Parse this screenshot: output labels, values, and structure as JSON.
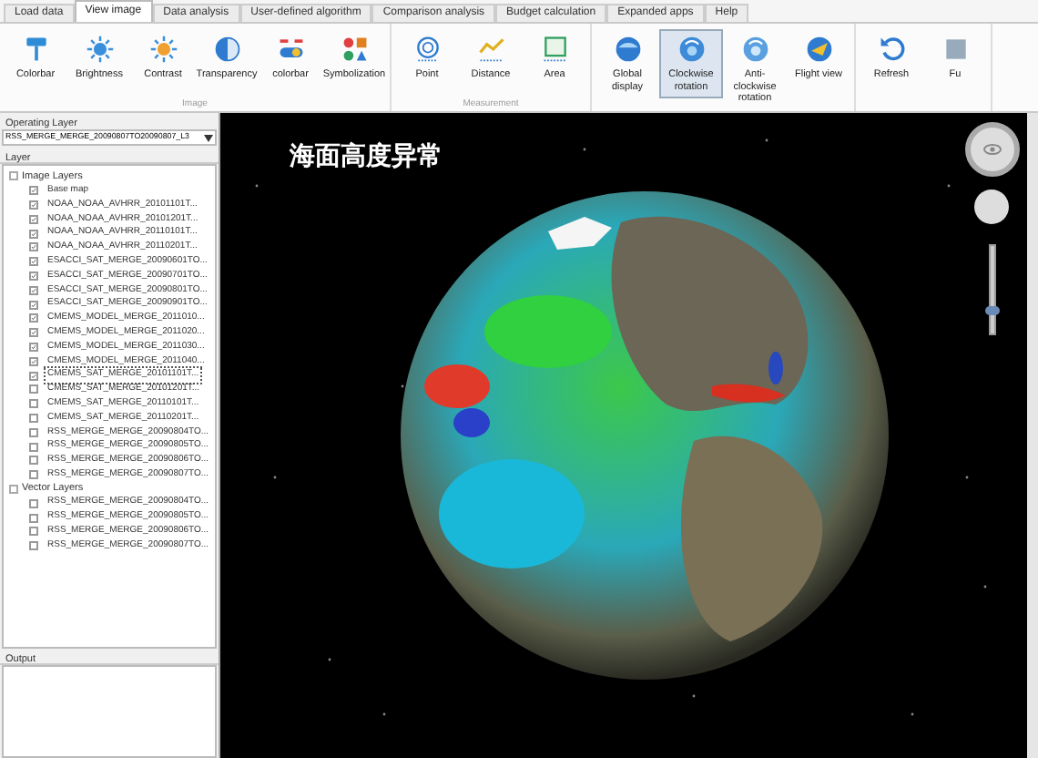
{
  "tabs": [
    {
      "label": "Load data",
      "selected": false
    },
    {
      "label": "View image",
      "selected": true
    },
    {
      "label": "Data analysis",
      "selected": false
    },
    {
      "label": "User-defined algorithm",
      "selected": false
    },
    {
      "label": "Comparison analysis",
      "selected": false
    },
    {
      "label": "Budget calculation",
      "selected": false
    },
    {
      "label": "Expanded apps",
      "selected": false
    },
    {
      "label": "Help",
      "selected": false
    }
  ],
  "ribbon": [
    {
      "group": "Image",
      "buttons": [
        {
          "label": "Colorbar",
          "selected": false
        },
        {
          "label": "Brightness",
          "selected": false
        },
        {
          "label": "Contrast",
          "selected": false
        },
        {
          "label": "Transparency",
          "selected": false
        },
        {
          "label": "colorbar",
          "selected": false
        },
        {
          "label": "Symbolization",
          "selected": false
        }
      ]
    },
    {
      "group": "Measurement",
      "buttons": [
        {
          "label": "Point",
          "selected": false
        },
        {
          "label": "Distance",
          "selected": false
        },
        {
          "label": "Area",
          "selected": false
        }
      ]
    },
    {
      "buttons": [
        {
          "label": "Global display",
          "selected": false
        },
        {
          "label": "Clockwise rotation",
          "selected": true
        },
        {
          "label": "Anti-clockwise rotation",
          "selected": false
        },
        {
          "label": "Flight view",
          "selected": false
        }
      ]
    },
    {
      "buttons": [
        {
          "label": "Refresh",
          "selected": false
        },
        {
          "label": "Fu",
          "selected": false
        }
      ]
    }
  ],
  "sidebar": {
    "operating_layer_label": "Operating Layer",
    "operating_layer": "RSS_MERGE_MERGE_20090807TO20090807_L3",
    "layer_label": "Layer",
    "tree": [
      {
        "label": "Image Layers",
        "children": [
          {
            "label": "Base map",
            "checked": true,
            "selected": false
          },
          {
            "label": "NOAA_NOAA_AVHRR_20101101T...",
            "checked": true,
            "selected": false
          },
          {
            "label": "NOAA_NOAA_AVHRR_20101201T...",
            "checked": true,
            "selected": false
          },
          {
            "label": "NOAA_NOAA_AVHRR_20110101T...",
            "checked": true,
            "selected": false
          },
          {
            "label": "NOAA_NOAA_AVHRR_20110201T...",
            "checked": true,
            "selected": false
          },
          {
            "label": "ESACCI_SAT_MERGE_20090601TO...",
            "checked": true,
            "selected": false
          },
          {
            "label": "ESACCI_SAT_MERGE_20090701TO...",
            "checked": true,
            "selected": false
          },
          {
            "label": "ESACCI_SAT_MERGE_20090801TO...",
            "checked": true,
            "selected": false
          },
          {
            "label": "ESACCI_SAT_MERGE_20090901TO...",
            "checked": true,
            "selected": false
          },
          {
            "label": "CMEMS_MODEL_MERGE_2011010...",
            "checked": true,
            "selected": false
          },
          {
            "label": "CMEMS_MODEL_MERGE_2011020...",
            "checked": true,
            "selected": false
          },
          {
            "label": "CMEMS_MODEL_MERGE_2011030...",
            "checked": true,
            "selected": false
          },
          {
            "label": "CMEMS_MODEL_MERGE_2011040...",
            "checked": true,
            "selected": false
          },
          {
            "label": "CMEMS_SAT_MERGE_20101101T...",
            "checked": true,
            "selected": true
          },
          {
            "label": "CMEMS_SAT_MERGE_20101201T...",
            "checked": false,
            "selected": false
          },
          {
            "label": "CMEMS_SAT_MERGE_20110101T...",
            "checked": false,
            "selected": false
          },
          {
            "label": "CMEMS_SAT_MERGE_20110201T...",
            "checked": false,
            "selected": false
          },
          {
            "label": "RSS_MERGE_MERGE_20090804TO...",
            "checked": false,
            "selected": false
          },
          {
            "label": "RSS_MERGE_MERGE_20090805TO...",
            "checked": false,
            "selected": false
          },
          {
            "label": "RSS_MERGE_MERGE_20090806TO...",
            "checked": false,
            "selected": false
          },
          {
            "label": "RSS_MERGE_MERGE_20090807TO...",
            "checked": false,
            "selected": false
          }
        ]
      },
      {
        "label": "Vector Layers",
        "children": [
          {
            "label": "RSS_MERGE_MERGE_20090804TO...",
            "checked": false,
            "selected": false
          },
          {
            "label": "RSS_MERGE_MERGE_20090805TO...",
            "checked": false,
            "selected": false
          },
          {
            "label": "RSS_MERGE_MERGE_20090806TO...",
            "checked": false,
            "selected": false
          },
          {
            "label": "RSS_MERGE_MERGE_20090807TO...",
            "checked": false,
            "selected": false
          }
        ]
      }
    ],
    "output_label": "Output"
  },
  "viewer": {
    "title": "海面高度异常",
    "zoom": {
      "level": 0.2
    }
  }
}
